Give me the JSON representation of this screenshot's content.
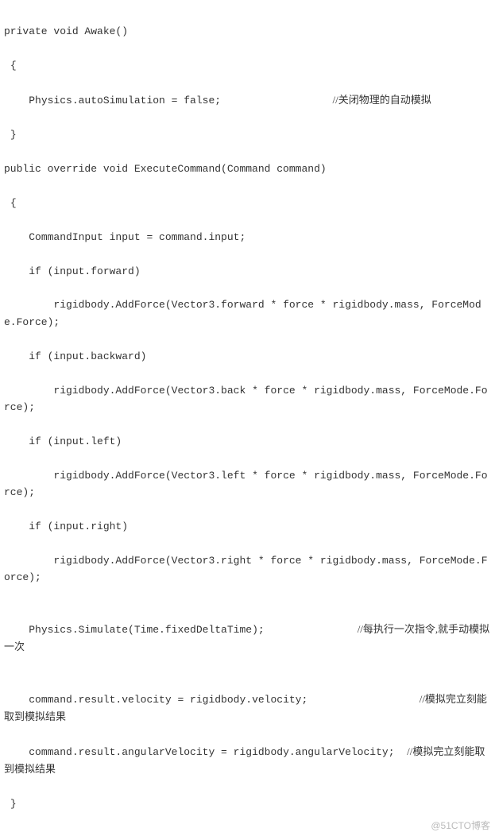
{
  "code": {
    "l1": "private void Awake()",
    "l2": " {",
    "l3a": "    Physics.autoSimulation = false;                  ",
    "l3b": "//关闭物理的自动模拟",
    "l4": " }",
    "l5": "public override void ExecuteCommand(Command command)",
    "l6": " {",
    "l7": "    CommandInput input = command.input;",
    "l8": "    if (input.forward)",
    "l9": "        rigidbody.AddForce(Vector3.forward * force * rigidbody.mass, ForceMode.Force);",
    "l10": "    if (input.backward)",
    "l11": "        rigidbody.AddForce(Vector3.back * force * rigidbody.mass, ForceMode.Force);",
    "l12": "    if (input.left)",
    "l13": "        rigidbody.AddForce(Vector3.left * force * rigidbody.mass, ForceMode.Force);",
    "l14": "    if (input.right)",
    "l15": "        rigidbody.AddForce(Vector3.right * force * rigidbody.mass, ForceMode.Force);",
    "l16": "",
    "l17a": "    Physics.Simulate(Time.fixedDeltaTime);               ",
    "l17b": "//每执行一次指令,就手动模拟一次",
    "l18": "",
    "l19a": "    command.result.velocity = rigidbody.velocity;                  ",
    "l19b": "//模拟完立刻能取到模拟结果",
    "l20a": "    command.result.angularVelocity = rigidbody.angularVelocity;  ",
    "l20b": "//模拟完立刻能取到模拟结果",
    "l21": " }"
  },
  "watermark": "@51CTO博客"
}
